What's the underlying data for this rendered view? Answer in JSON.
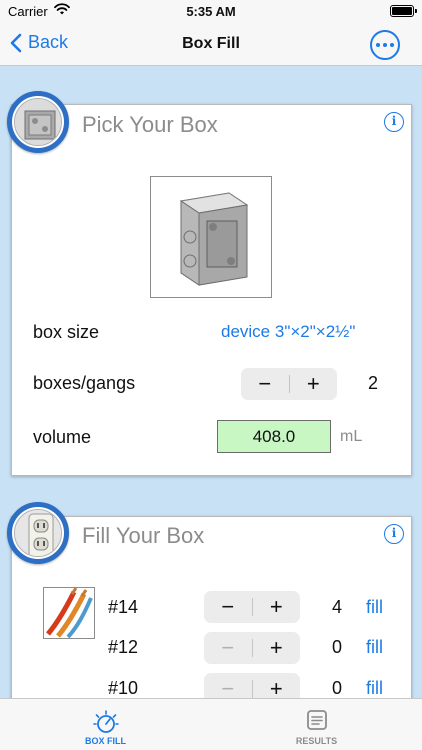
{
  "status_bar": {
    "carrier": "Carrier",
    "time": "5:35 AM"
  },
  "nav": {
    "back_label": "Back",
    "title": "Box Fill"
  },
  "pick_box": {
    "title": "Pick Your Box",
    "box_size_label": "box size",
    "box_size_value": "device 3\"×2\"×2½\"",
    "boxes_label": "boxes/gangs",
    "boxes_count": "2",
    "volume_label": "volume",
    "volume_value": "408.0",
    "volume_unit": "mL"
  },
  "fill_box": {
    "title": "Fill Your Box",
    "fill_link": "fill",
    "wires": [
      {
        "gauge": "#14",
        "count": "4"
      },
      {
        "gauge": "#12",
        "count": "0"
      },
      {
        "gauge": "#10",
        "count": "0"
      }
    ]
  },
  "tabs": [
    {
      "label": "BOX FILL",
      "icon": "box-fill-icon",
      "active": true
    },
    {
      "label": "RESULTS",
      "icon": "results-icon",
      "active": false
    }
  ],
  "colors": {
    "accent": "#1e7ae6",
    "badge_ring": "#2c6fc4",
    "volume_bg": "#c8f7c4",
    "background": "#c9e1f5"
  }
}
